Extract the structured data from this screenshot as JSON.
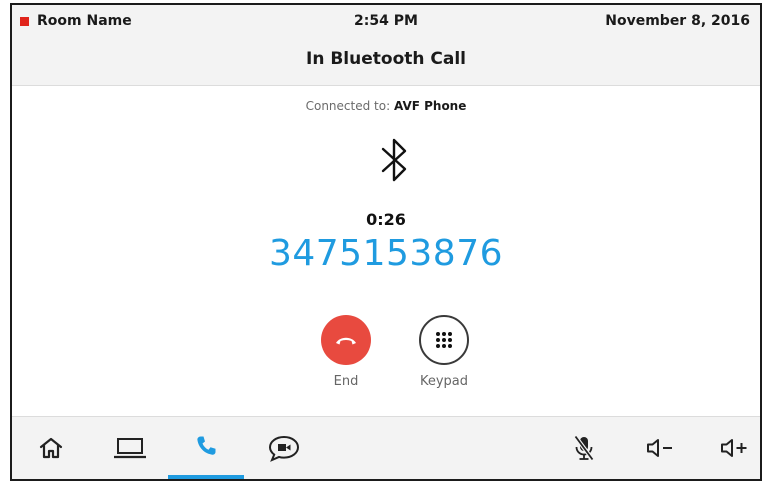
{
  "status": {
    "room_name": "Room Name",
    "time": "2:54 PM",
    "date": "November 8, 2016",
    "room_indicator_color": "#e0241b"
  },
  "call": {
    "title": "In Bluetooth Call",
    "connected_prefix": "Connected to:",
    "device_name": "AVF Phone",
    "duration": "0:26",
    "number": "3475153876",
    "number_color": "#1f9be0"
  },
  "actions": {
    "end_label": "End",
    "keypad_label": "Keypad",
    "end_color": "#e84a3f"
  },
  "nav": {
    "items": [
      {
        "name": "home",
        "icon": "home-icon"
      },
      {
        "name": "presentation",
        "icon": "laptop-icon"
      },
      {
        "name": "phone",
        "icon": "phone-icon",
        "active": true
      },
      {
        "name": "video-conference",
        "icon": "video-chat-icon"
      }
    ],
    "controls": [
      {
        "name": "mic-mute",
        "icon": "mic-muted-icon"
      },
      {
        "name": "volume-down",
        "icon": "volume-down-icon"
      },
      {
        "name": "volume-up",
        "icon": "volume-up-icon"
      }
    ],
    "accent_color": "#1f9be0"
  }
}
